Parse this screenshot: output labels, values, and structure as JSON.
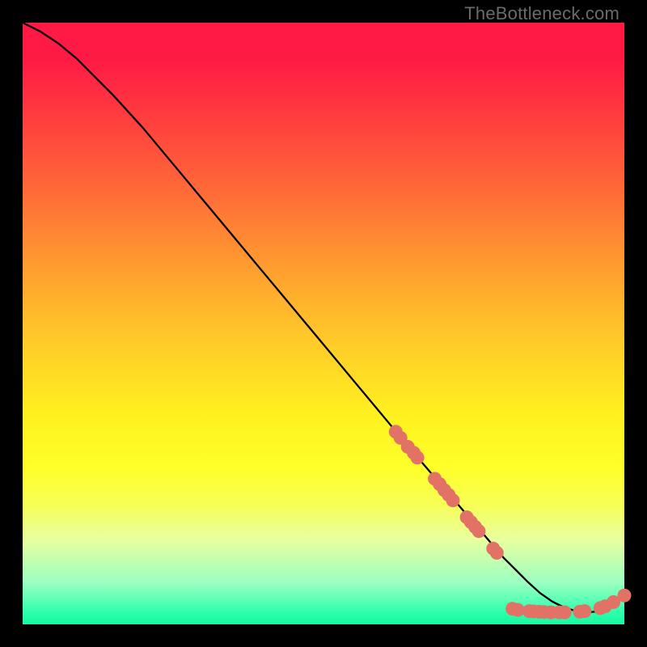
{
  "watermark": "TheBottleneck.com",
  "colors": {
    "point_fill": "#e27265",
    "curve_stroke": "#000000"
  },
  "chart_data": {
    "type": "line",
    "title": "",
    "xlabel": "",
    "ylabel": "",
    "xlim": [
      0,
      100
    ],
    "ylim": [
      0,
      100
    ],
    "grid": false,
    "legend": false,
    "background": "red-yellow-green vertical gradient",
    "series": [
      {
        "name": "bottleneck-curve",
        "note": "Monotone curve descending from top-left, flattening near bottom-right, with a small uptick at far right. Values are estimated from pixel positions (no axis labels visible).",
        "x": [
          0,
          3,
          6,
          9,
          12,
          15,
          20,
          25,
          30,
          35,
          40,
          45,
          50,
          55,
          60,
          65,
          68,
          71,
          74,
          77,
          80,
          82,
          84,
          86,
          88,
          90,
          92,
          94,
          96,
          98,
          100
        ],
        "y": [
          100,
          98.5,
          96.5,
          94,
          91,
          88,
          82.5,
          76.5,
          70.5,
          64.5,
          58.5,
          52.5,
          46.5,
          40.5,
          34.5,
          28.5,
          25,
          21.5,
          18,
          14.5,
          11,
          9,
          7,
          5.2,
          3.8,
          2.8,
          2.2,
          2.0,
          2.2,
          3.0,
          4.8
        ]
      }
    ],
    "points": {
      "name": "highlighted-data-points",
      "note": "Scatter markers along the lower portion of the curve; values estimated.",
      "coords": [
        [
          62,
          32
        ],
        [
          62.8,
          31
        ],
        [
          64,
          29.5
        ],
        [
          65,
          28.5
        ],
        [
          65.6,
          27.7
        ],
        [
          68.5,
          24.2
        ],
        [
          69.3,
          23.3
        ],
        [
          70.1,
          22.3
        ],
        [
          70.8,
          21.5
        ],
        [
          71.5,
          20.6
        ],
        [
          73.8,
          17.8
        ],
        [
          74.5,
          17
        ],
        [
          75.2,
          16.2
        ],
        [
          75.8,
          15.5
        ],
        [
          78.2,
          12.6
        ],
        [
          78.8,
          11.9
        ],
        [
          81.4,
          2.6
        ],
        [
          82.3,
          2.4
        ],
        [
          84.2,
          2.2
        ],
        [
          84.9,
          2.15
        ],
        [
          85.8,
          2.1
        ],
        [
          86.6,
          2.05
        ],
        [
          87.8,
          2.0
        ],
        [
          89.2,
          2.0
        ],
        [
          90.1,
          2.0
        ],
        [
          92.6,
          2.1
        ],
        [
          93.4,
          2.2
        ],
        [
          96.0,
          2.7
        ],
        [
          96.8,
          3.0
        ],
        [
          98.2,
          3.7
        ],
        [
          100,
          4.8
        ]
      ]
    }
  }
}
